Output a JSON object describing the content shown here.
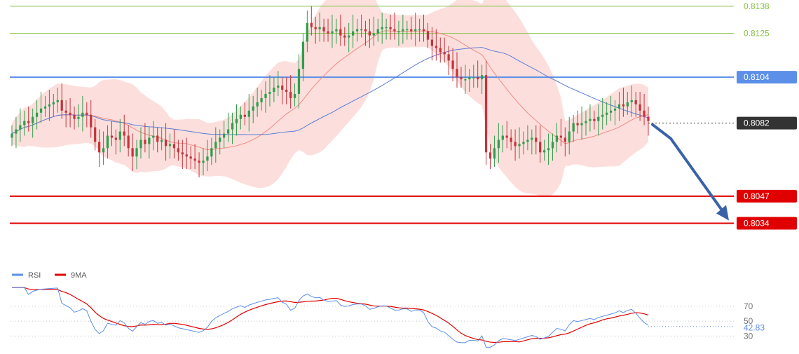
{
  "chart_data": [
    {
      "type": "candlestick",
      "title": "",
      "ylim": [
        0.801,
        0.8141
      ],
      "levels": [
        {
          "value": 0.8138,
          "label": "0.8138",
          "color": "#8bc34a",
          "style": "thin",
          "tag": "text"
        },
        {
          "value": 0.8125,
          "label": "0.8125",
          "color": "#8bc34a",
          "style": "thin",
          "tag": "text"
        },
        {
          "value": 0.8104,
          "label": "0.8104",
          "color": "#5b8fe8",
          "style": "thick",
          "tag": "box"
        },
        {
          "value": 0.8082,
          "label": "0.8082",
          "color": "#333333",
          "style": "dotted",
          "tag": "box"
        },
        {
          "value": 0.8047,
          "label": "0.8047",
          "color": "#e00000",
          "style": "thick",
          "tag": "box"
        },
        {
          "value": 0.8034,
          "label": "0.8034",
          "color": "#e00000",
          "style": "thick",
          "tag": "box"
        }
      ],
      "current_price": 0.8082,
      "forecast_arrow": {
        "from": 0.8082,
        "to": 0.8034,
        "color": "#3a62a8",
        "direction": "down"
      },
      "colors": {
        "bull": "#2e9e4d",
        "bear": "#c8323a",
        "band_fill": "#f9c4c0",
        "ma_fast": "#f28b82",
        "ma_slow": "#5b7bd5"
      },
      "closes": [
        0.8077,
        0.8079,
        0.8081,
        0.8083,
        0.8082,
        0.8085,
        0.8087,
        0.8089,
        0.809,
        0.8091,
        0.8092,
        0.8093,
        0.8088,
        0.8087,
        0.8086,
        0.8084,
        0.8085,
        0.8087,
        0.8086,
        0.808,
        0.8073,
        0.8068,
        0.807,
        0.8076,
        0.8075,
        0.8074,
        0.8078,
        0.8076,
        0.807,
        0.8066,
        0.807,
        0.8074,
        0.8072,
        0.8075,
        0.8076,
        0.8073,
        0.8074,
        0.8071,
        0.8072,
        0.807,
        0.8068,
        0.8067,
        0.8066,
        0.8065,
        0.8064,
        0.8063,
        0.8064,
        0.8066,
        0.807,
        0.8073,
        0.8075,
        0.8077,
        0.8079,
        0.8082,
        0.8084,
        0.8086,
        0.8085,
        0.8088,
        0.809,
        0.8092,
        0.8094,
        0.8096,
        0.8097,
        0.8099,
        0.81,
        0.8098,
        0.8097,
        0.8094,
        0.8096,
        0.8108,
        0.8121,
        0.813,
        0.8128,
        0.8127,
        0.8128,
        0.8126,
        0.8125,
        0.8126,
        0.8127,
        0.8124,
        0.8123,
        0.8124,
        0.8126,
        0.8127,
        0.8127,
        0.8126,
        0.8124,
        0.8125,
        0.8127,
        0.8128,
        0.8128,
        0.8127,
        0.8126,
        0.8126,
        0.8127,
        0.8127,
        0.8126,
        0.8127,
        0.8127,
        0.8126,
        0.8122,
        0.8119,
        0.8118,
        0.8116,
        0.8115,
        0.8112,
        0.8108,
        0.8104,
        0.8103,
        0.8103,
        0.8104,
        0.8104,
        0.8103,
        0.8105,
        0.8068,
        0.8065,
        0.807,
        0.8074,
        0.8076,
        0.8075,
        0.8073,
        0.8071,
        0.8072,
        0.8073,
        0.8074,
        0.8075,
        0.8073,
        0.8068,
        0.8069,
        0.807,
        0.8073,
        0.8076,
        0.8075,
        0.8073,
        0.8078,
        0.8082,
        0.8081,
        0.8082,
        0.8083,
        0.8084,
        0.8083,
        0.8085,
        0.8086,
        0.8087,
        0.8088,
        0.8089,
        0.8091,
        0.809,
        0.8092,
        0.8093,
        0.8091,
        0.8088,
        0.8085,
        0.8083
      ]
    },
    {
      "type": "line",
      "ylim": [
        20,
        100
      ],
      "yticks": [
        30,
        50,
        70
      ],
      "series": [
        {
          "name": "RSI",
          "color": "#5b8fe8"
        },
        {
          "name": "9MA",
          "color": "#e00000"
        }
      ],
      "last_value": 42.83
    }
  ],
  "legend": {
    "rsi": "RSI",
    "ma": "9MA"
  }
}
